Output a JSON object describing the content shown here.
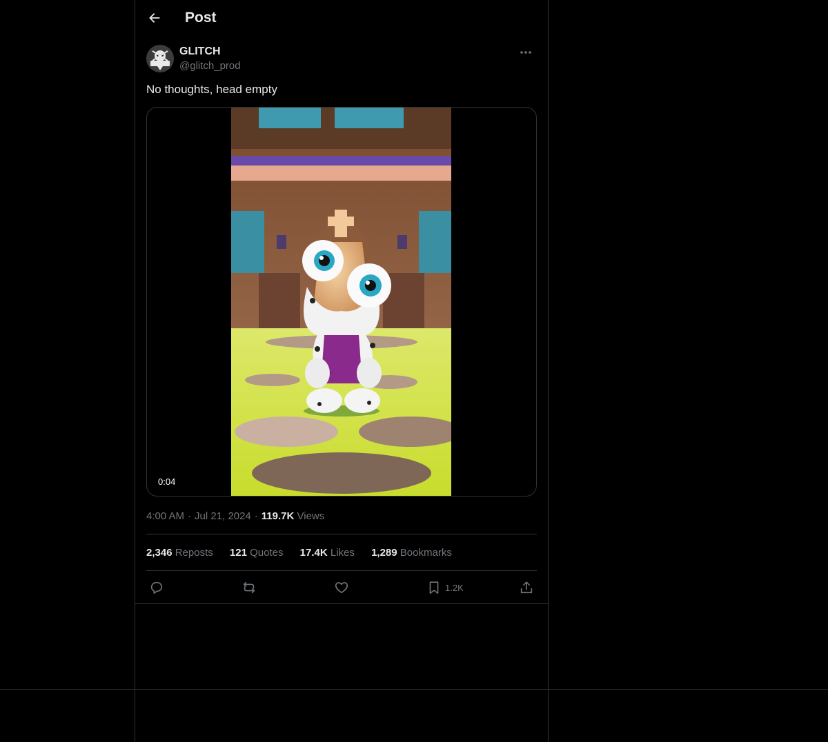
{
  "header": {
    "title": "Post",
    "back_icon": "arrow-left-icon"
  },
  "author": {
    "display_name": "GLITCH",
    "handle": "@glitch_prod",
    "avatar_text": "GLITCH",
    "more_icon": "ellipsis-icon"
  },
  "tweet": {
    "text": "No thoughts, head empty"
  },
  "media": {
    "type": "video",
    "time": "0:04"
  },
  "meta": {
    "time": "4:00 AM",
    "date": "Jul 21, 2024",
    "views_count": "119.7K",
    "views_label": "Views"
  },
  "stats": [
    {
      "count": "2,346",
      "label": "Reposts"
    },
    {
      "count": "121",
      "label": "Quotes"
    },
    {
      "count": "17.4K",
      "label": "Likes"
    },
    {
      "count": "1,289",
      "label": "Bookmarks"
    }
  ],
  "actions": {
    "reply_icon": "reply-icon",
    "repost_icon": "repost-icon",
    "like_icon": "heart-icon",
    "bookmark_icon": "bookmark-icon",
    "bookmark_count": "1.2K",
    "share_icon": "share-icon"
  },
  "colors": {
    "background": "#000000",
    "text_primary": "#e7e9ea",
    "text_secondary": "#71767b",
    "border": "#2f3336"
  }
}
